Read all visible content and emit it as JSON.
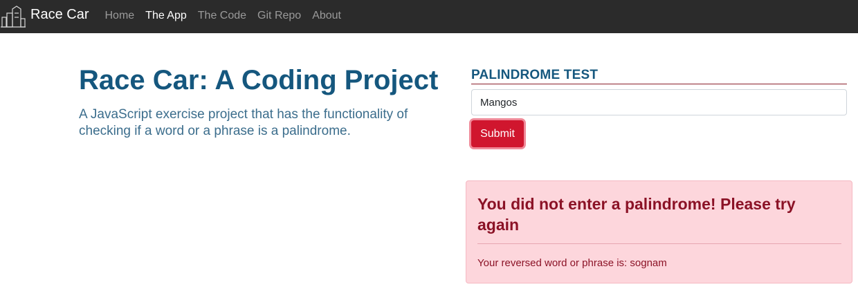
{
  "navbar": {
    "brand": "Race Car",
    "links": [
      {
        "label": "Home",
        "active": false
      },
      {
        "label": "The App",
        "active": true
      },
      {
        "label": "The Code",
        "active": false
      },
      {
        "label": "Git Repo",
        "active": false
      },
      {
        "label": "About",
        "active": false
      }
    ]
  },
  "hero": {
    "title": "Race Car: A Coding Project",
    "description": "A JavaScript exercise project that has the functionality of checking if a word or a phrase is a palindrome."
  },
  "form": {
    "heading": "PALINDROME TEST",
    "input_value": "Mangos",
    "submit_label": "Submit"
  },
  "alert": {
    "heading": "You did not enter a palindrome! Please try again",
    "body": "Your reversed word or phrase is: sognam"
  },
  "colors": {
    "navbar_bg": "#2b2b2b",
    "primary_blue": "#15577e",
    "submit_red": "#d0162e",
    "alert_bg": "#fdd6dc",
    "alert_text": "#8b1226"
  }
}
